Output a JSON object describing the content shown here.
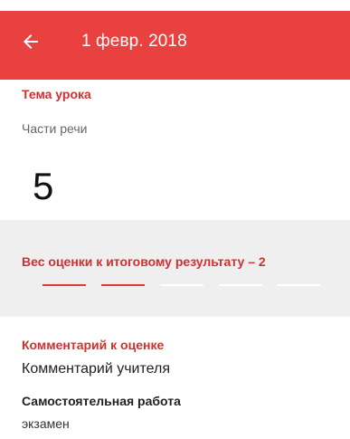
{
  "app_bar": {
    "title": "1 февр. 2018",
    "back_icon": "arrow-left-icon",
    "color": "#e9413f"
  },
  "lesson": {
    "topic_label": "Тема урока",
    "topic_value": "Части речи",
    "grade": "5"
  },
  "weight": {
    "label": "Вес оценки к итоговому результату – 2",
    "value": 2,
    "max": 5,
    "active_color": "#e53935"
  },
  "comment": {
    "label": "Комментарий к оценке",
    "value": "Комментарий учителя"
  },
  "work": {
    "type": "Самостоятельная работа",
    "value": "экзамен"
  }
}
